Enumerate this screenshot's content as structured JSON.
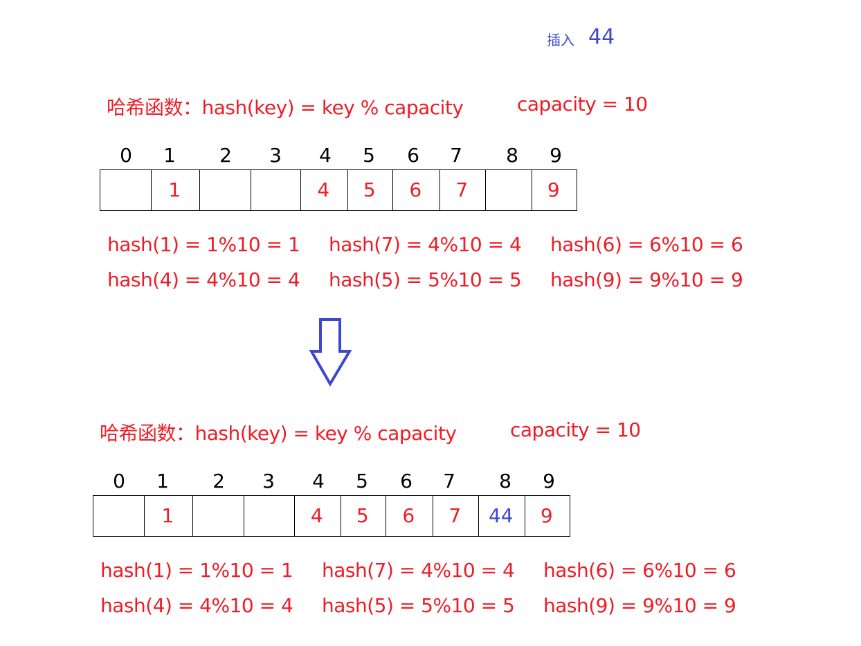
{
  "insert": {
    "label": "插入",
    "value": "44"
  },
  "colors": {
    "red": "#ee1c25",
    "blue": "#3f48cc",
    "black": "#000000"
  },
  "before": {
    "hash_function": "哈希函数：hash(key) = key % capacity",
    "capacity": "capacity = 10",
    "indices": [
      "0",
      "1",
      "2",
      "3",
      "4",
      "5",
      "6",
      "7",
      "8",
      "9"
    ],
    "cells": [
      "",
      "1",
      "",
      "",
      "4",
      "5",
      "6",
      "7",
      "",
      "9"
    ],
    "equations": [
      [
        "hash(1) = 1%10 = 1",
        "hash(7) = 4%10 = 4",
        "hash(6) = 6%10 = 6"
      ],
      [
        "hash(4) = 4%10 = 4",
        "hash(5) = 5%10 = 5",
        "hash(9) = 9%10 = 9"
      ]
    ]
  },
  "after": {
    "hash_function": "哈希函数：hash(key) = key % capacity",
    "capacity": "capacity = 10",
    "indices": [
      "0",
      "1",
      "2",
      "3",
      "4",
      "5",
      "6",
      "7",
      "8",
      "9"
    ],
    "cells": [
      "",
      "1",
      "",
      "",
      "4",
      "5",
      "6",
      "7",
      "44",
      "9"
    ],
    "highlight_index": 8,
    "equations": [
      [
        "hash(1) = 1%10 = 1",
        "hash(7) = 4%10 = 4",
        "hash(6) = 6%10 = 6"
      ],
      [
        "hash(4) = 4%10 = 4",
        "hash(5) = 5%10 = 5",
        "hash(9) = 9%10 = 9"
      ]
    ]
  },
  "arrow": {
    "icon": "down-arrow-icon",
    "color": "#3f48cc"
  }
}
